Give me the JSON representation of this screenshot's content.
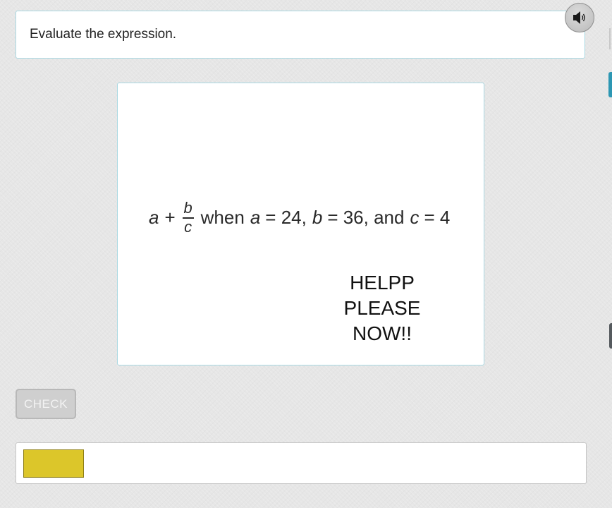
{
  "prompt": {
    "text": "Evaluate the expression."
  },
  "audio_button": {
    "icon": "speaker-icon"
  },
  "question_image": {
    "expression": {
      "a": "a",
      "plus": "+",
      "numerator": "b",
      "denominator": "c",
      "when": "when",
      "a_var": "a",
      "a_eq": "= 24,",
      "b_var": "b",
      "b_eq": "= 36, and",
      "c_var": "c",
      "c_eq": "= 4"
    },
    "help_lines": [
      "HELPP",
      "PLEASE",
      "NOW!!"
    ]
  },
  "check_button": {
    "label": "CHECK"
  },
  "answer": {
    "value": "",
    "input_color": "#dcc62a"
  },
  "colors": {
    "accent_border": "#a9d8e2",
    "side_tab_active": "#2d97b3"
  }
}
